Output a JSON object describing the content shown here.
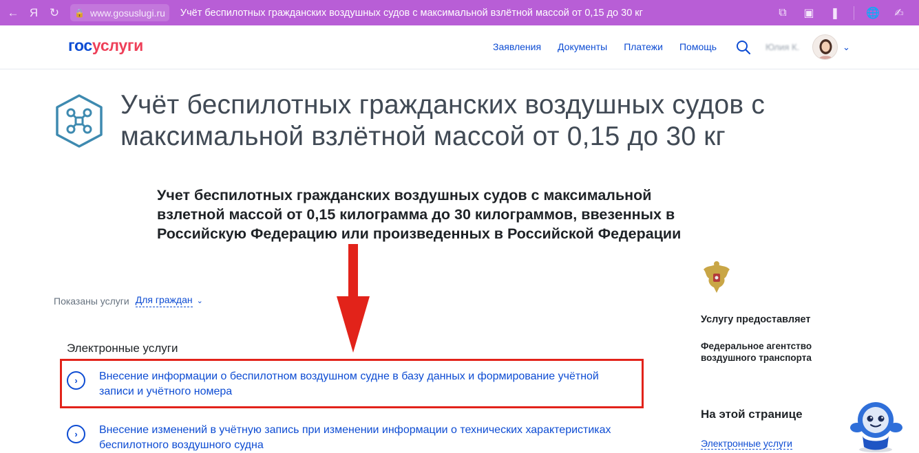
{
  "browser": {
    "url": "www.gosuslugi.ru",
    "tab_title": "Учёт беспилотных гражданских воздушных судов с максимальной взлётной массой от 0,15 до 30 кг"
  },
  "header": {
    "logo_gos": "гос",
    "logo_uslugi": "услуги",
    "nav": [
      "Заявления",
      "Документы",
      "Платежи",
      "Помощь"
    ],
    "user_name": "Юлия К."
  },
  "title": "Учёт беспилотных гражданских воздушных судов с максимальной взлётной массой от 0,15 до 30 кг",
  "description": "Учет беспилотных гражданских воздушных судов с максимальной взлетной массой от 0,15 килограмма до 30 килограммов, ввезенных в Российскую Федерацию или произведенных в Российской Федерации",
  "filter": {
    "label": "Показаны услуги",
    "value": "Для граждан"
  },
  "section_heading": "Электронные услуги",
  "services": [
    "Внесение информации о беспилотном воздушном судне в базу данных и формирование учётной записи и учётного номера",
    "Внесение изменений в учётную запись при изменении информации о технических характеристиках беспилотного воздушного судна"
  ],
  "sidebar": {
    "provider_label": "Услугу предоставляет",
    "provider_name": "Федеральное агентство воздушного транспорта",
    "on_page_label": "На этой странице",
    "on_page_link": "Электронные услуги"
  },
  "colors": {
    "browser_bar": "#b85ed6",
    "brand_blue": "#0d4cd3",
    "brand_red": "#ee3f58",
    "highlight": "#e2231a",
    "icon_teal": "#3e8ab0"
  }
}
